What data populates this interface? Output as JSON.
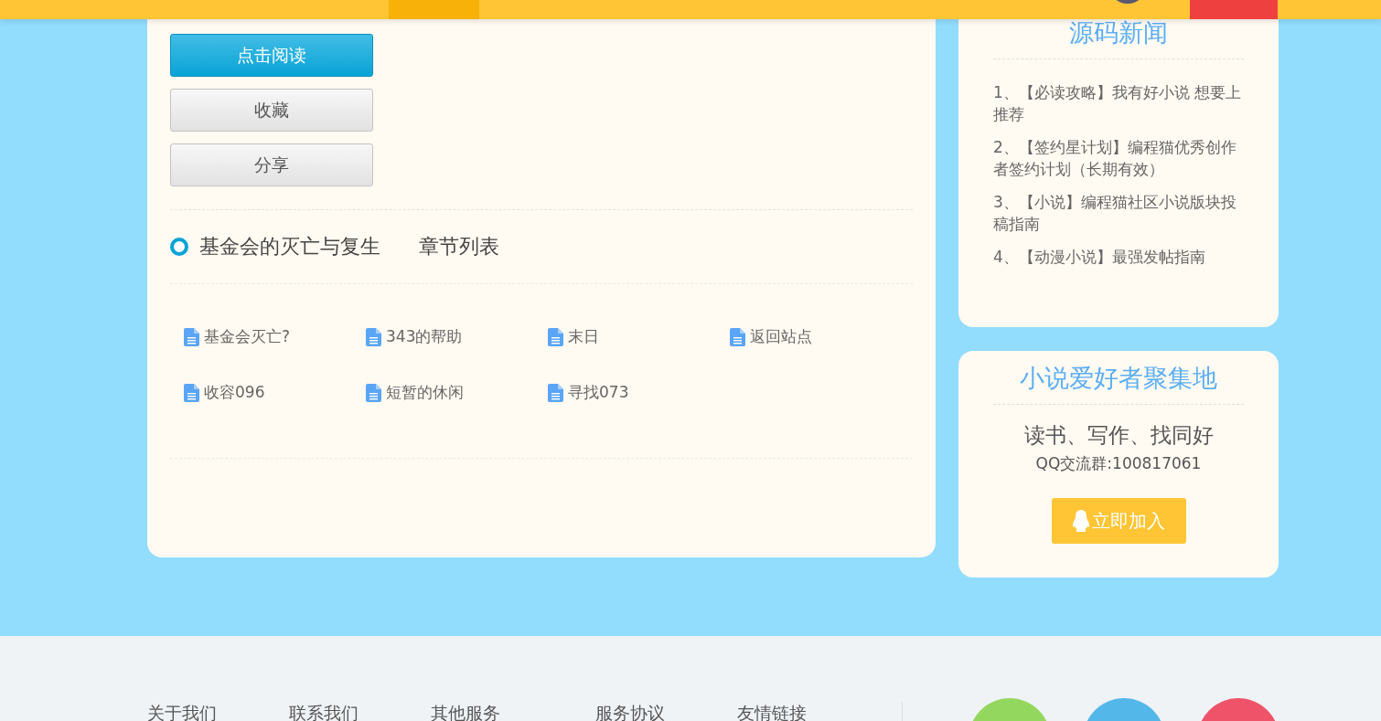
{
  "top_bar": {
    "tabs": [
      {
        "selected": true
      },
      {
        "kind": "alert"
      }
    ]
  },
  "book": {
    "buttons": [
      {
        "label": "点击阅读",
        "kind": "primary"
      },
      {
        "label": "收藏",
        "kind": "plain"
      },
      {
        "label": "分享",
        "kind": "plain"
      }
    ],
    "title": "基金会的灭亡与复生",
    "section": "章节列表",
    "chapters": [
      "基金会灭亡?",
      "343的帮助",
      "末日",
      "返回站点",
      "收容096",
      "短暂的休闲",
      "寻找073"
    ]
  },
  "news": {
    "title": "源码新闻",
    "items": [
      "1、【必读攻略】我有好小说 想要上推荐",
      "2、【签约星计划】编程猫优秀创作者签约计划（长期有效）",
      "3、【小说】编程猫社区小说版块投稿指南",
      "4、【动漫小说】最强发帖指南"
    ]
  },
  "group": {
    "title": "小说爱好者聚集地",
    "slogan": "读书、写作、找同好",
    "qq": "QQ交流群:100817061",
    "join": "立即加入"
  },
  "footer": {
    "links": [
      "关于我们",
      "联系我们",
      "其他服务",
      "服务协议",
      "友情链接"
    ],
    "circles": [
      {
        "color": "#94d75e"
      },
      {
        "color": "#53b7ea"
      },
      {
        "color": "#ef5369"
      }
    ]
  }
}
